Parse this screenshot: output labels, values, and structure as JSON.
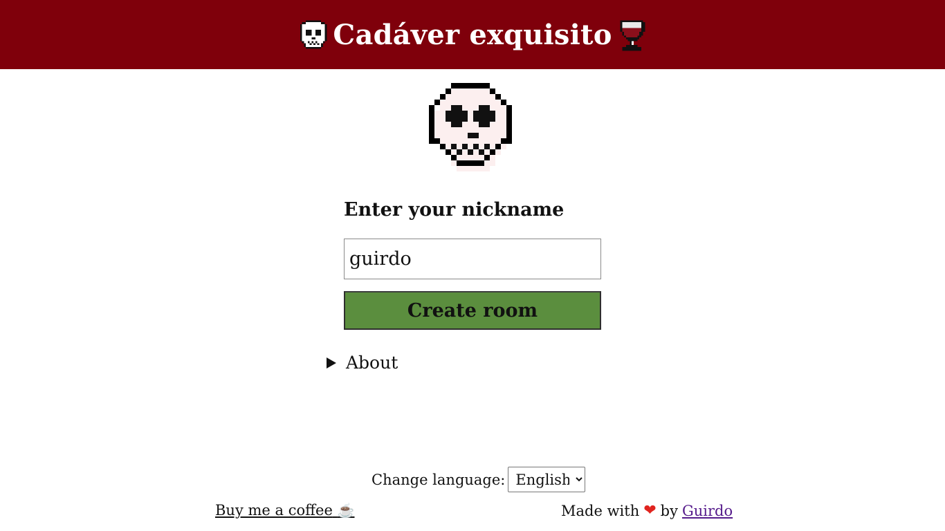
{
  "header": {
    "title": "Cadáver exquisito",
    "left_icon": "skull-icon",
    "right_icon": "wine-glass-icon",
    "background": "#7f000b"
  },
  "main": {
    "logo_icon": "skull-icon",
    "nickname_label": "Enter your nickname",
    "nickname_value": "guirdo",
    "create_button_label": "Create room",
    "create_button_color": "#5b8e3e",
    "about_label": "About"
  },
  "footer": {
    "change_language_label": "Change language:",
    "language_selected": "English",
    "coffee_link_label": "Buy me a coffee",
    "coffee_icon": "☕",
    "made_with_label": "Made with",
    "heart_icon": "❤",
    "by_label": "by",
    "author_link_label": "Guirdo"
  }
}
